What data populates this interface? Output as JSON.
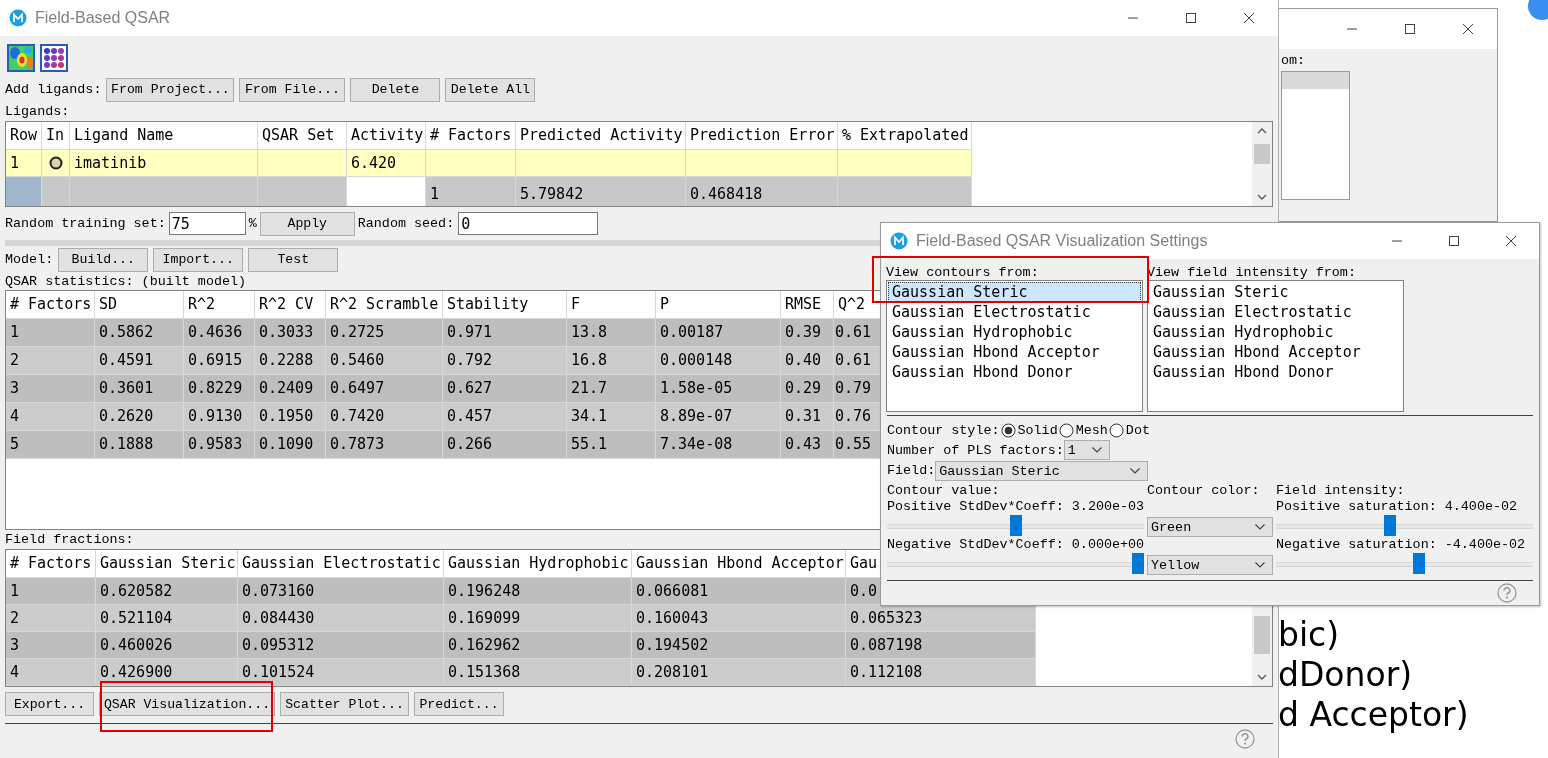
{
  "main_window": {
    "title": "Field-Based QSAR",
    "add_ligands": {
      "label": "Add ligands:",
      "buttons": [
        "From Project...",
        "From File...",
        "Delete",
        "Delete All"
      ]
    },
    "ligands_label": "Ligands:",
    "ligands_table": {
      "columns": [
        "Row",
        "In",
        "Ligand Name",
        "QSAR Set",
        "Activity",
        "# Factors",
        "Predicted Activity",
        "Prediction Error",
        "% Extrapolated"
      ],
      "rows": [
        {
          "selected": true,
          "included": true,
          "cells": [
            "1",
            null,
            "imatinib",
            null,
            "6.420",
            null,
            null,
            null,
            null
          ]
        },
        {
          "selected": false,
          "included": false,
          "cells": [
            null,
            null,
            null,
            null,
            null,
            "1",
            "5.79842",
            "0.468418",
            null
          ]
        }
      ]
    },
    "training": {
      "label": "Random training set:",
      "value": "75",
      "unit": "%",
      "apply": "Apply",
      "seed_label": "Random seed:",
      "seed": "0"
    },
    "model": {
      "label": "Model:",
      "buttons": [
        "Build...",
        "Import...",
        "Test"
      ]
    },
    "stats_label": "QSAR statistics: (built model)",
    "stats_table": {
      "columns": [
        "# Factors",
        "SD",
        "R^2",
        "R^2 CV",
        "R^2 Scramble",
        "Stability",
        "F",
        "P",
        "RMSE",
        "Q^2"
      ],
      "rows": [
        [
          "1",
          "0.5862",
          "0.4636",
          "0.3033",
          "0.2725",
          "0.971",
          "13.8",
          "0.00187",
          "0.39",
          "0.61"
        ],
        [
          "2",
          "0.4591",
          "0.6915",
          "0.2288",
          "0.5460",
          "0.792",
          "16.8",
          "0.000148",
          "0.40",
          "0.61"
        ],
        [
          "3",
          "0.3601",
          "0.8229",
          "0.2409",
          "0.6497",
          "0.627",
          "21.7",
          "1.58e-05",
          "0.29",
          "0.79"
        ],
        [
          "4",
          "0.2620",
          "0.9130",
          "0.1950",
          "0.7420",
          "0.457",
          "34.1",
          "8.89e-07",
          "0.31",
          "0.76"
        ],
        [
          "5",
          "0.1888",
          "0.9583",
          "0.1090",
          "0.7873",
          "0.266",
          "55.1",
          "7.34e-08",
          "0.43",
          "0.55"
        ]
      ]
    },
    "fractions_label": "Field fractions:",
    "fractions_table": {
      "columns": [
        "# Factors",
        "Gaussian Steric",
        "Gaussian Electrostatic",
        "Gaussian Hydrophobic",
        "Gaussian Hbond Acceptor",
        "Gau"
      ],
      "rows": [
        [
          "1",
          "0.620582",
          "0.073160",
          "0.196248",
          "0.066081",
          "0.0"
        ],
        [
          "2",
          "0.521104",
          "0.084430",
          "0.169099",
          "0.160043",
          "0.065323"
        ],
        [
          "3",
          "0.460026",
          "0.095312",
          "0.162962",
          "0.194502",
          "0.087198"
        ],
        [
          "4",
          "0.426900",
          "0.101524",
          "0.151368",
          "0.208101",
          "0.112108"
        ]
      ]
    },
    "bottom_buttons": [
      "Export...",
      "QSAR Visualization...",
      "Scatter Plot...",
      "Predict..."
    ]
  },
  "background_window": {
    "label": "om:"
  },
  "background_text": [
    "bic)",
    "dDonor)",
    "d Acceptor)"
  ],
  "dialog": {
    "title": "Field-Based QSAR Visualization Settings",
    "contours_label": "View contours from:",
    "contour_sources": [
      {
        "label": "Gaussian Steric",
        "selected": true
      },
      {
        "label": "Gaussian Electrostatic",
        "selected": false
      },
      {
        "label": "Gaussian Hydrophobic",
        "selected": false
      },
      {
        "label": "Gaussian Hbond Acceptor",
        "selected": false
      },
      {
        "label": "Gaussian Hbond Donor",
        "selected": false
      }
    ],
    "intensity_label": "View field intensity from:",
    "intensity_sources": [
      {
        "label": "Gaussian Steric",
        "selected": false
      },
      {
        "label": "Gaussian Electrostatic",
        "selected": false
      },
      {
        "label": "Gaussian Hydrophobic",
        "selected": false
      },
      {
        "label": "Gaussian Hbond Acceptor",
        "selected": false
      },
      {
        "label": "Gaussian Hbond Donor",
        "selected": false
      }
    ],
    "contour_style": {
      "label": "Contour style:",
      "options": [
        {
          "label": "Solid",
          "selected": true
        },
        {
          "label": "Mesh",
          "selected": false
        },
        {
          "label": "Dot",
          "selected": false
        }
      ]
    },
    "pls_factors": {
      "label": "Number of PLS factors:",
      "value": "1"
    },
    "field": {
      "label": "Field:",
      "value": "Gaussian Steric"
    },
    "contour_value": {
      "label": "Contour value:",
      "positive": {
        "label": "Positive StdDev*Coeff: 3.200e-03",
        "level": 0.5
      },
      "negative": {
        "label": "Negative StdDev*Coeff: 0.000e+00",
        "level": 1
      }
    },
    "contour_color": {
      "label": "Contour color:",
      "positive": "Green",
      "negative": "Yellow"
    },
    "field_intensity": {
      "label": "Field intensity:",
      "positive": {
        "label": "Positive saturation: 4.400e-02",
        "level": 0.44
      },
      "negative": {
        "label": "Negative saturation: -4.400e-02",
        "level": 0.56
      }
    }
  }
}
